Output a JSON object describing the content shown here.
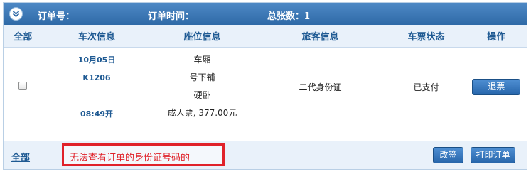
{
  "header": {
    "order_no_label": "订单号：",
    "order_no_value": "",
    "order_time_label": "订单时间：",
    "order_time_value": "",
    "total_label": "总张数：",
    "total_value": "1"
  },
  "columns": [
    "全部",
    "车次信息",
    "座位信息",
    "旅客信息",
    "车票状态",
    "操作"
  ],
  "ticket": {
    "date": "10月05日",
    "train_no": "K1206",
    "departure": "08:49开",
    "carriage": "车厢",
    "berth": "号下铺",
    "seat_class": "硬卧",
    "fare": "成人票, 377.00元",
    "id_type": "二代身份证",
    "status": "已支付",
    "refund_label": "退票"
  },
  "footer": {
    "select_all": "全部",
    "note": "无法查看订单的身份证号码的",
    "rebook_label": "改签",
    "print_label": "打印订单"
  },
  "colors": {
    "header_blue": "#2f6aa7",
    "annotation_red": "#e0222a"
  }
}
